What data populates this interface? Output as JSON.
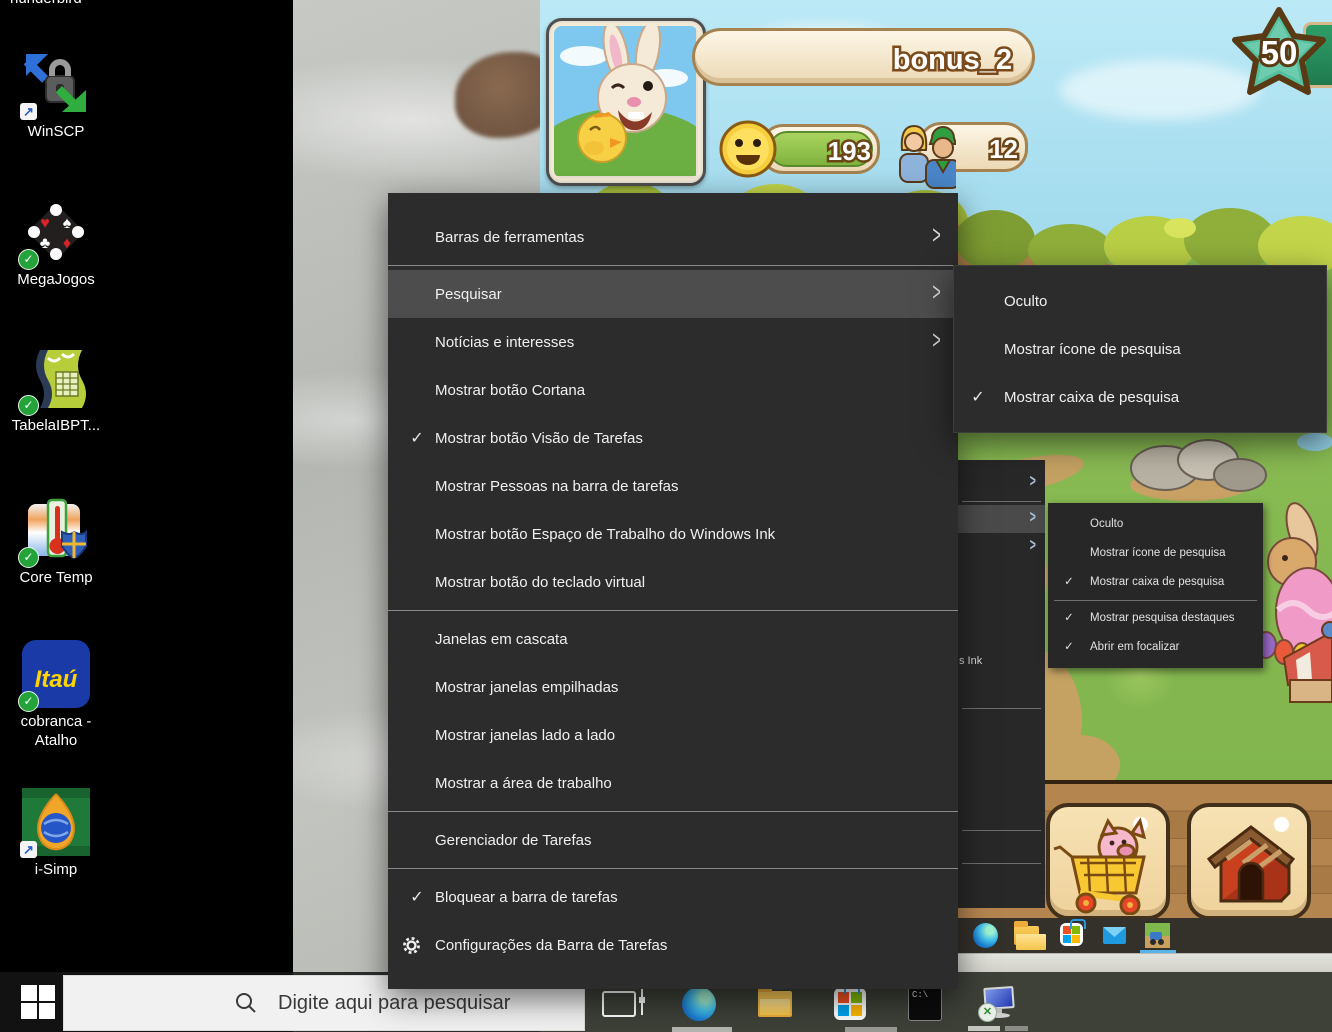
{
  "desktop": {
    "top_clipped_label": "hunderbird",
    "icons": [
      {
        "label": "WinSCP"
      },
      {
        "label": "MegaJogos"
      },
      {
        "label": "TabelaIBPT..."
      },
      {
        "label": "Core Temp"
      },
      {
        "label_line1": "cobranca -",
        "label_line2": "Atalho",
        "icon_text": "Itaú"
      },
      {
        "label": "i-Simp"
      }
    ]
  },
  "context_menu": {
    "items": [
      {
        "label": "Barras de ferramentas",
        "has_submenu": true
      },
      {
        "label": "Pesquisar",
        "has_submenu": true,
        "highlighted": true
      },
      {
        "label": "Notícias e interesses",
        "has_submenu": true
      },
      {
        "label": "Mostrar botão Cortana"
      },
      {
        "label": "Mostrar botão Visão de Tarefas",
        "checked": true
      },
      {
        "label": "Mostrar Pessoas na barra de tarefas"
      },
      {
        "label": "Mostrar botão Espaço de Trabalho do Windows Ink"
      },
      {
        "label": "Mostrar botão do teclado virtual"
      },
      {
        "label": "Janelas em cascata"
      },
      {
        "label": "Mostrar janelas empilhadas"
      },
      {
        "label": "Mostrar janelas lado a lado"
      },
      {
        "label": "Mostrar a área de trabalho"
      },
      {
        "label": "Gerenciador de Tarefas"
      },
      {
        "label": "Bloquear a barra de tarefas",
        "checked": true
      },
      {
        "label": "Configurações da Barra de Tarefas",
        "has_gear_icon": true
      }
    ]
  },
  "search_submenu": {
    "items": [
      {
        "label": "Oculto"
      },
      {
        "label": "Mostrar ícone de pesquisa"
      },
      {
        "label": "Mostrar caixa de pesquisa",
        "checked": true
      }
    ]
  },
  "mini_screenshot": {
    "menu_fragment": "s Ink",
    "submenu_items": [
      {
        "label": "Oculto"
      },
      {
        "label": "Mostrar ícone de pesquisa"
      },
      {
        "label": "Mostrar caixa de pesquisa",
        "checked": true
      },
      {
        "label": "Mostrar pesquisa destaques",
        "checked": true
      },
      {
        "label": "Abrir em focalizar",
        "checked": true
      }
    ]
  },
  "game": {
    "player_name": "bonus_2",
    "mood_value": "193",
    "friends_value": "12",
    "star_value": "50"
  },
  "taskbar": {
    "search_placeholder": "Digite aqui para pesquisar",
    "cmd_icon_text": "C:\\"
  }
}
